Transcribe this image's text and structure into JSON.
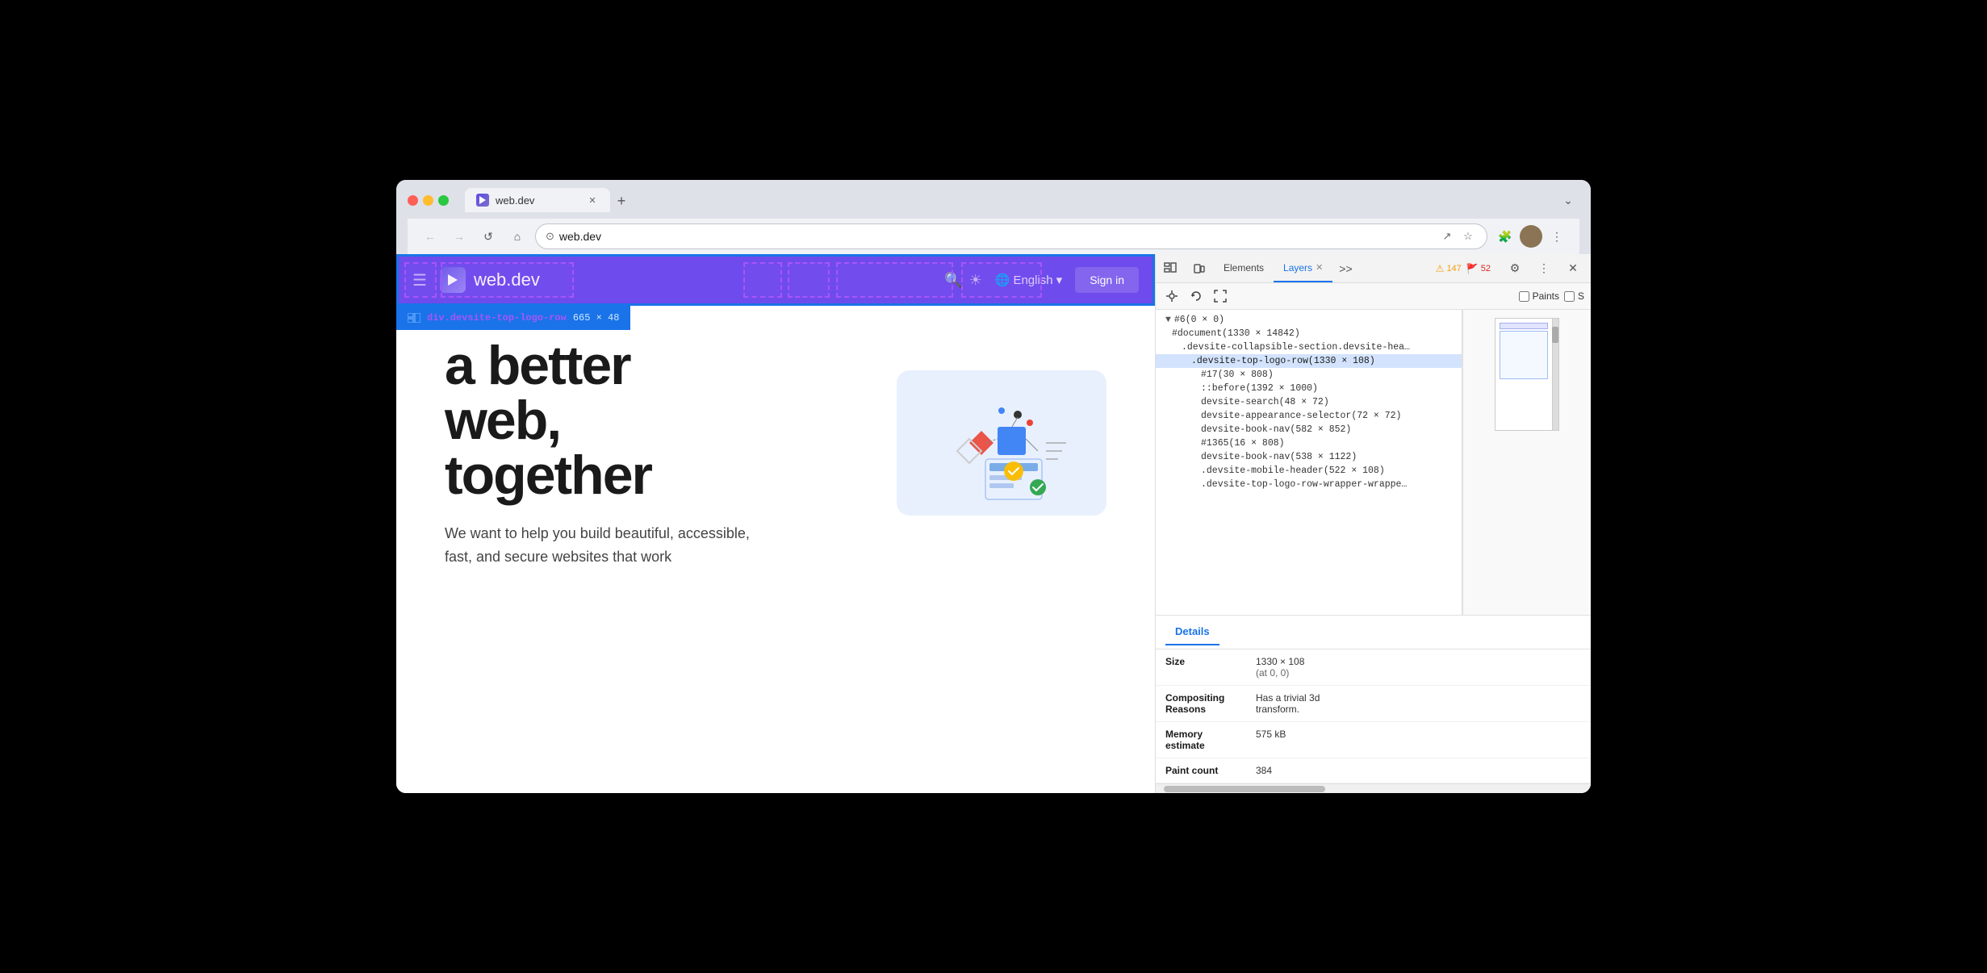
{
  "browser": {
    "traffic_lights": [
      "red",
      "yellow",
      "green"
    ],
    "tab_title": "web.dev",
    "tab_favicon": "▶",
    "tab_close": "✕",
    "tab_new": "+",
    "nav_back": "←",
    "nav_forward": "→",
    "nav_reload": "↺",
    "nav_home": "⌂",
    "address_icon": "⊙",
    "address_url": "web.dev",
    "address_share": "↗",
    "address_star": "☆",
    "extensions_icon": "🧩",
    "profile_menu": "⋮",
    "window_collapse": "⌄"
  },
  "webpage": {
    "header_menu_icon": "☰",
    "header_logo_text": "web.dev",
    "header_search_icon": "🔍",
    "header_theme_icon": "☀",
    "header_lang_text": "English",
    "header_lang_icon": "🌐",
    "header_lang_arrow": "▾",
    "header_signin": "Sign in",
    "element_tooltip_class": "div.devsite-top-logo-row",
    "element_tooltip_dims": "665 × 48",
    "heading_line1": "a better",
    "heading_line2": "web,",
    "heading_line3": "together",
    "description": "We want to help you build beautiful, accessible, fast, and secure websites that work"
  },
  "devtools": {
    "elements_tab": "Elements",
    "layers_tab": "Layers",
    "layers_tab_close": "✕",
    "more_tabs": ">>",
    "badge_warning_icon": "⚠",
    "badge_warning_count": "147",
    "badge_error_icon": "🚩",
    "badge_error_count": "52",
    "settings_icon": "⚙",
    "more_options": "⋮",
    "close_icon": "✕",
    "toolbar": {
      "pan_icon": "✥",
      "rotate_icon": "↺",
      "fit_icon": "⤡",
      "paints_label": "Paints",
      "paints_checked": false,
      "s_label": "S",
      "s_checked": false
    },
    "layers": [
      {
        "id": "root",
        "label": "#6(0 × 0)",
        "indent": 0,
        "arrow": "▼",
        "selected": false
      },
      {
        "id": "doc",
        "label": "#document(1330 × 14842)",
        "indent": 1,
        "arrow": "",
        "selected": false
      },
      {
        "id": "collapsible",
        "label": ".devsite-collapsible-section.devsite-hea…",
        "indent": 2,
        "arrow": "",
        "selected": false
      },
      {
        "id": "top-logo-row",
        "label": ".devsite-top-logo-row(1330 × 108)",
        "indent": 3,
        "arrow": "",
        "selected": true
      },
      {
        "id": "17",
        "label": "#17(30 × 808)",
        "indent": 4,
        "arrow": "",
        "selected": false
      },
      {
        "id": "before",
        "label": "::before(1392 × 1000)",
        "indent": 4,
        "arrow": "",
        "selected": false
      },
      {
        "id": "devsite-search",
        "label": "devsite-search(48 × 72)",
        "indent": 4,
        "arrow": "",
        "selected": false
      },
      {
        "id": "appearance-selector",
        "label": "devsite-appearance-selector(72 × 72)",
        "indent": 4,
        "arrow": "",
        "selected": false
      },
      {
        "id": "book-nav-1",
        "label": "devsite-book-nav(582 × 852)",
        "indent": 4,
        "arrow": "",
        "selected": false
      },
      {
        "id": "1365",
        "label": "#1365(16 × 808)",
        "indent": 4,
        "arrow": "",
        "selected": false
      },
      {
        "id": "book-nav-2",
        "label": "devsite-book-nav(538 × 1122)",
        "indent": 4,
        "arrow": "",
        "selected": false
      },
      {
        "id": "mobile-header",
        "label": ".devsite-mobile-header(522 × 108)",
        "indent": 4,
        "arrow": "",
        "selected": false
      },
      {
        "id": "logo-row-wrapper",
        "label": ".devsite-top-logo-row-wrapper-wrappe…",
        "indent": 4,
        "arrow": "",
        "selected": false
      }
    ],
    "details": {
      "header": "Details",
      "size_label": "Size",
      "size_value": "1330 × 108\n(at 0, 0)",
      "compositing_label": "Compositing\nReasons",
      "compositing_value": "Has a trivial 3d\ntransform.",
      "memory_label": "Memory\nestimate",
      "memory_value": "575 kB",
      "paint_count_label": "Paint count",
      "paint_count_value": "384"
    }
  }
}
